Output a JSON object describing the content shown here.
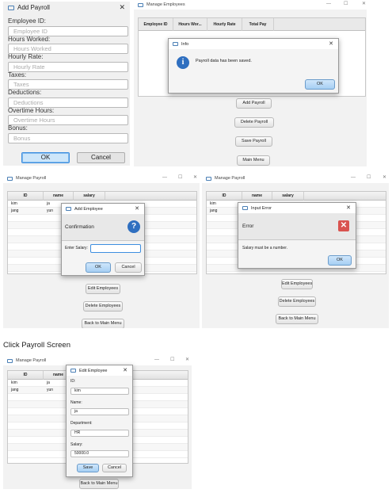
{
  "add_payroll": {
    "title": "Add Payroll",
    "close": "✕",
    "fields": [
      {
        "label": "Employee ID:",
        "placeholder": "Employee ID"
      },
      {
        "label": "Hours Worked:",
        "placeholder": "Hours Worked"
      },
      {
        "label": "Hourly Rate:",
        "placeholder": "Hourly Rate"
      },
      {
        "label": "Taxes:",
        "placeholder": "Taxes"
      },
      {
        "label": "Deductions:",
        "placeholder": "Deductions"
      },
      {
        "label": "Overtime Hours:",
        "placeholder": "Overtime Hours"
      },
      {
        "label": "Bonus:",
        "placeholder": "Bonus"
      }
    ],
    "ok_label": "OK",
    "cancel_label": "Cancel"
  },
  "manage_employees": {
    "title": "Manage Employees",
    "controls": {
      "minimize": "—",
      "maximize": "☐",
      "close": "✕"
    },
    "columns": [
      "Employee ID",
      "Hours Wor...",
      "Hourly Rate",
      "Total Pay"
    ],
    "buttons": [
      "Add Payroll",
      "Delete Payroll",
      "Save Payroll",
      "Main Menu"
    ],
    "info_dialog": {
      "title": "Info",
      "message": "Payroll data has been saved.",
      "ok_label": "OK",
      "icon": "info-icon",
      "close": "✕"
    }
  },
  "manage_payroll_add": {
    "title": "Manage Payroll",
    "controls": {
      "minimize": "—",
      "maximize": "☐",
      "close": "✕"
    },
    "columns": [
      "ID",
      "name",
      "salary"
    ],
    "rows": [
      [
        "kim",
        "ja",
        ""
      ],
      [
        "jang",
        "yun",
        ""
      ]
    ],
    "buttons": [
      "Edit Employees",
      "Delete Employees",
      "Back to Main Menu"
    ],
    "dialog": {
      "title": "Add Employee",
      "header": "Confirmation",
      "icon": "question-icon",
      "field_label": "Enter Salary:",
      "field_value": "",
      "ok_label": "OK",
      "cancel_label": "Cancel",
      "close": "✕"
    }
  },
  "manage_payroll_error": {
    "title": "Manage Payroll",
    "controls": {
      "minimize": "—",
      "maximize": "☐",
      "close": "✕"
    },
    "columns": [
      "ID",
      "name",
      "salary"
    ],
    "rows": [
      [
        "kim",
        "",
        ""
      ],
      [
        "jang",
        "",
        ""
      ]
    ],
    "buttons": [
      "Edit Employees",
      "Delete Employees",
      "Back to Main Menu"
    ],
    "dialog": {
      "title": "Input Error",
      "header": "Error",
      "icon": "error-icon",
      "message": "Salary must be a number.",
      "ok_label": "OK",
      "close": "✕"
    }
  },
  "caption": "Click Payroll Screen",
  "manage_payroll_edit": {
    "title": "Manage Payroll",
    "controls": {
      "minimize": "—",
      "maximize": "☐",
      "close": "✕"
    },
    "columns": [
      "ID",
      "name"
    ],
    "rows": [
      [
        "kim",
        "ja"
      ],
      [
        "jang",
        "yun"
      ]
    ],
    "buttons": [
      "Back to Main Menu"
    ],
    "dialog": {
      "title": "Edit Employee",
      "close": "✕",
      "fields": [
        {
          "label": "ID:",
          "value": "kim"
        },
        {
          "label": "Name:",
          "value": "ja"
        },
        {
          "label": "Department:",
          "value": "HR"
        },
        {
          "label": "Salary:",
          "value": "50000.0"
        }
      ],
      "save_label": "Save",
      "cancel_label": "Cancel"
    }
  },
  "colors": {
    "accent_blue": "#3d8ee0",
    "info_icon": "#2f6fc0",
    "error_icon": "#d9534f"
  }
}
